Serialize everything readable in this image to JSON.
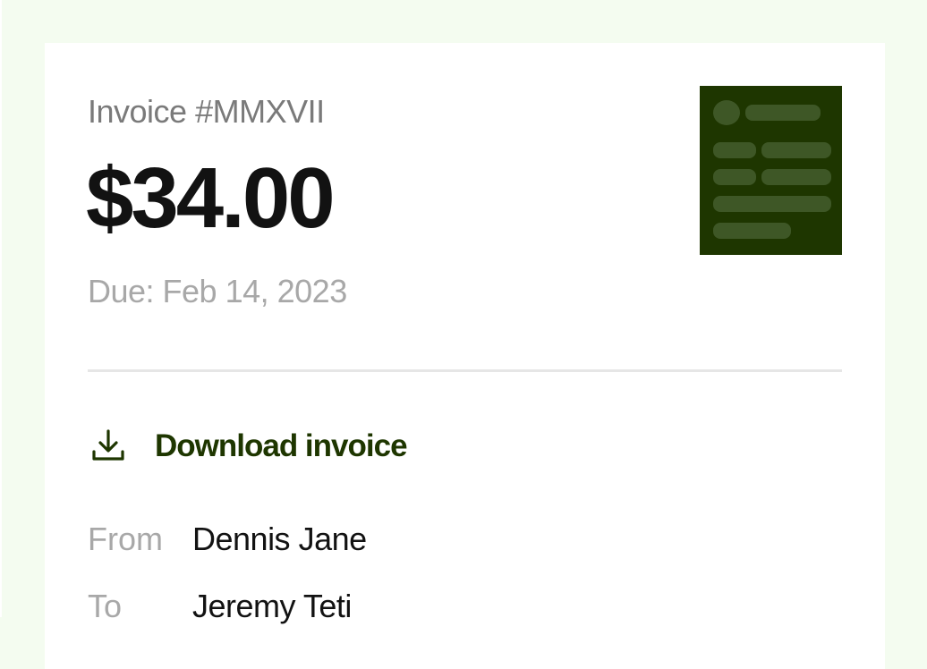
{
  "invoice": {
    "number": "Invoice #MMXVII",
    "amount": "$34.00",
    "due": "Due: Feb 14, 2023"
  },
  "actions": {
    "download_label": "Download invoice",
    "download_icon": "download-icon"
  },
  "details": {
    "from_label": "From",
    "from_value": "Dennis Jane",
    "to_label": "To",
    "to_value": "Jeremy Teti"
  },
  "colors": {
    "page_background": "#f4fcf0",
    "card_background": "#ffffff",
    "accent": "#1e3600",
    "thumbnail_block": "#3e5726",
    "muted_text": "#a8a8a8",
    "primary_text": "#121212"
  }
}
